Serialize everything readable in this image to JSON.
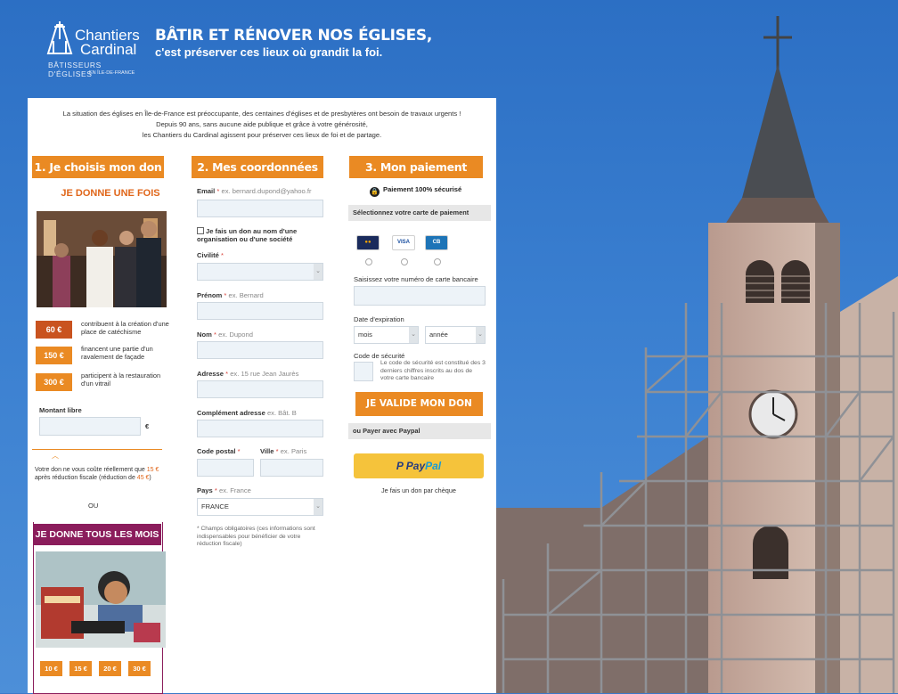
{
  "header": {
    "logo_line1": "Chantiers",
    "logo_line2": "Cardinal",
    "logo_sub1": "BÂTISSEURS D'ÉGLISES",
    "logo_sub2": "EN ÎLE-DE-FRANCE",
    "title": "BÂTIR ET RÉNOVER NOS ÉGLISES,",
    "subtitle": "c'est préserver ces lieux où grandit la foi."
  },
  "intro": {
    "line1": "La situation des églises en Île-de-France est préoccupante, des centaines d'églises et de presbytères ont besoin de travaux urgents !",
    "line2": "Depuis 90 ans, sans aucune aide publique et grâce à votre générosité,",
    "line3": "les Chantiers du Cardinal agissent pour préserver ces lieux de foi et de partage."
  },
  "step1": {
    "title": "1. Je choisis mon don",
    "once_title": "JE DONNE UNE FOIS",
    "amounts": [
      {
        "label": "60 €",
        "text": "contribuent à la création d'une place de catéchisme"
      },
      {
        "label": "150 €",
        "text": "financent une partie d'un ravalement de façade"
      },
      {
        "label": "300 €",
        "text": "participent à la restauration d'un vitrail"
      }
    ],
    "free_label": "Montant libre",
    "currency": "€",
    "tax_pre": "Votre don ne vous coûte réellement que",
    "tax_amount": "15 €",
    "tax_mid": "après réduction fiscale (réduction de",
    "tax_reduction": "45 €",
    "tax_post": ")",
    "or": "OU",
    "monthly_title": "JE DONNE TOUS LES MOIS",
    "monthly_amounts": [
      "10 €",
      "15 €",
      "20 €",
      "30 €"
    ]
  },
  "step2": {
    "title": "2. Mes coordonnées",
    "email_label": "Email",
    "email_example": "ex. bernard.dupond@yahoo.fr",
    "org_checkbox": "Je fais un don au nom d'une organisation ou d'une société",
    "civility_label": "Civilité",
    "firstname_label": "Prénom",
    "firstname_example": "ex. Bernard",
    "lastname_label": "Nom",
    "lastname_example": "ex. Dupond",
    "address_label": "Adresse",
    "address_example": "ex. 15 rue Jean Jaurès",
    "address2_label": "Complément adresse",
    "address2_example": "ex. Bât. B",
    "zip_label": "Code postal",
    "city_label": "Ville",
    "city_example": "ex. Paris",
    "country_label": "Pays",
    "country_example": "ex. France",
    "country_value": "FRANCE",
    "required_star": "*",
    "required_note": "* Champs obligatoires (ces informations sont indispensables pour bénéficier de votre réduction fiscale)"
  },
  "step3": {
    "title": "3. Mon paiement",
    "secure": "Paiement 100% sécurisé",
    "card_select": "Sélectionnez votre carte de paiement",
    "cards": [
      "MasterCard",
      "VISA",
      "CB"
    ],
    "card_number": "Saisissez votre numéro de carte bancaire",
    "expiry_label": "Date d'expiration",
    "month": "mois",
    "year": "année",
    "cvv_label": "Code de sécurité",
    "cvv_help": "Le code de sécurité est constitué des 3 derniers chiffres inscrits au dos de votre carte bancaire",
    "submit": "JE VALIDE MON DON",
    "paypal_or": "ou Payer avec Paypal",
    "paypal_p": "P",
    "paypal_pay": "Pay",
    "paypal_pal": "Pal",
    "cheque": "Je fais un don par chèque"
  },
  "colors": {
    "accent": "#ea8a23",
    "dark_accent": "#c9531f",
    "monthly": "#8b1d5c",
    "sky": "#3a7fd0"
  }
}
